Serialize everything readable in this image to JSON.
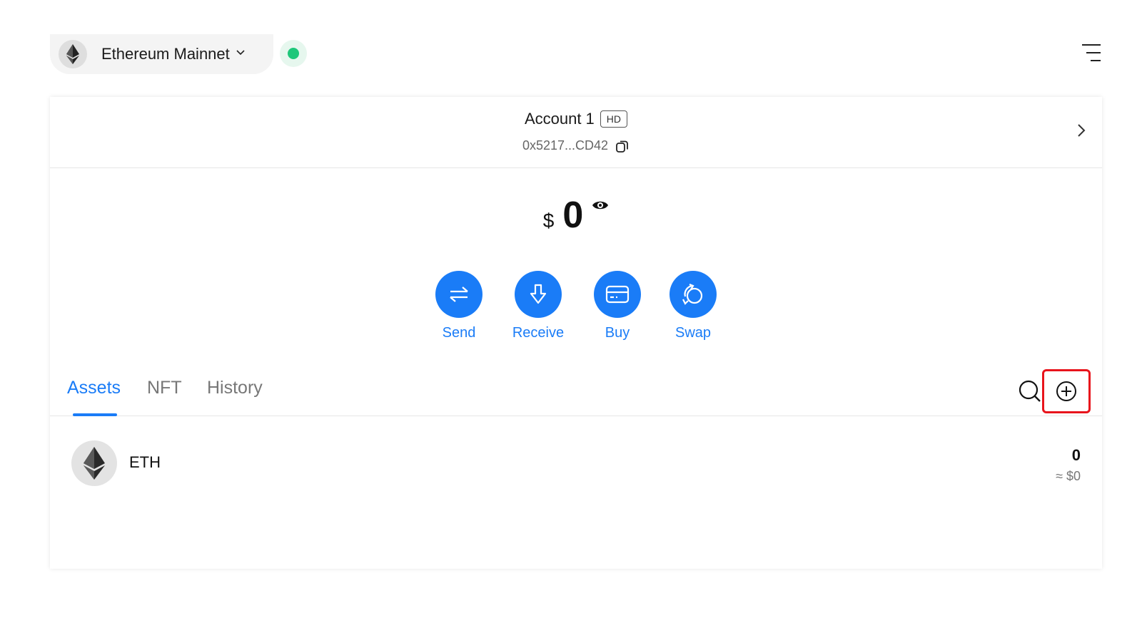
{
  "network": {
    "name": "Ethereum Mainnet",
    "icon": "ethereum-icon",
    "status": "connected",
    "status_color": "#1ec77a"
  },
  "header": {
    "menu_icon": "menu-icon"
  },
  "account": {
    "name": "Account 1",
    "badge": "HD",
    "address": "0x5217...CD42"
  },
  "balance": {
    "currency": "$",
    "value": "0"
  },
  "actions": [
    {
      "label": "Send",
      "icon": "send-arrows-icon"
    },
    {
      "label": "Receive",
      "icon": "receive-icon"
    },
    {
      "label": "Buy",
      "icon": "card-icon"
    },
    {
      "label": "Swap",
      "icon": "swap-icon"
    }
  ],
  "tabs": [
    {
      "label": "Assets",
      "active": true
    },
    {
      "label": "NFT",
      "active": false
    },
    {
      "label": "History",
      "active": false
    }
  ],
  "assets": [
    {
      "symbol": "ETH",
      "amount": "0",
      "fiat": "≈ $0",
      "icon": "ethereum-icon"
    }
  ],
  "colors": {
    "accent": "#1a7cf7",
    "highlight": "#e8141c"
  }
}
